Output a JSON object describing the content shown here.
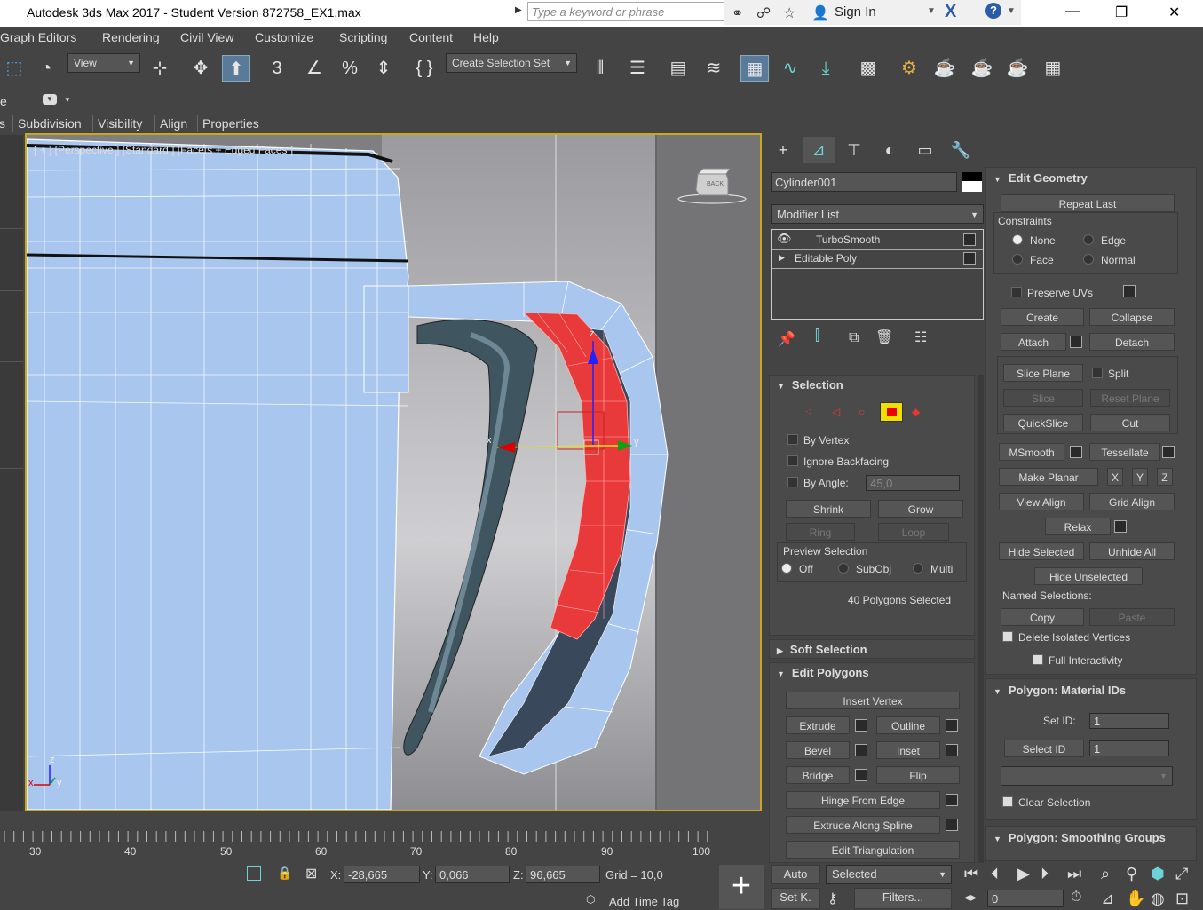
{
  "window": {
    "title": "Autodesk 3ds Max 2017 - Student Version    872758_EX1.max",
    "search_placeholder": "Type a keyword or phrase",
    "sign_in": "Sign In",
    "minimize": "—",
    "restore": "❐",
    "close": "✕"
  },
  "menu": [
    "Graph Editors",
    "Rendering",
    "Civil View",
    "Customize",
    "Scripting",
    "Content",
    "Help"
  ],
  "toolbar": {
    "view_dropdown": "View",
    "selection_set": "Create Selection Set"
  },
  "row2": {
    "left_text": "e"
  },
  "ribbon": [
    "s",
    "Subdivision",
    "Visibility",
    "Align",
    "Properties"
  ],
  "viewport": {
    "label": "[ + ] [Perspective ] [Standard ] [Facets + Edged Faces ]",
    "viewcube_label": "BACK",
    "gizmo": {
      "x": "x",
      "y": "y",
      "z": "z"
    },
    "axis": {
      "x": "x",
      "y": "y",
      "z": "z"
    }
  },
  "timeline": {
    "ticks": [
      "30",
      "40",
      "50",
      "60",
      "70",
      "80",
      "90",
      "100"
    ]
  },
  "status": {
    "x_label": "X:",
    "x_value": "-28,665",
    "y_label": "Y:",
    "y_value": "0,066",
    "z_label": "Z:",
    "z_value": "96,665",
    "grid": "Grid = 10,0",
    "add_time_tag": "Add Time Tag",
    "auto": "Auto",
    "set_key": "Set K.",
    "selected": "Selected",
    "filters": "Filters...",
    "frame": "0"
  },
  "command_panel": {
    "object_name": "Cylinder001",
    "modifier_list": "Modifier List",
    "stack": [
      "TurboSmooth",
      "Editable Poly"
    ],
    "selection": {
      "title": "Selection",
      "by_vertex": "By Vertex",
      "ignore_backfacing": "Ignore Backfacing",
      "by_angle": "By Angle:",
      "angle_value": "45,0",
      "shrink": "Shrink",
      "grow": "Grow",
      "ring": "Ring",
      "loop": "Loop",
      "preview_selection": "Preview Selection",
      "off": "Off",
      "subobj": "SubObj",
      "multi": "Multi",
      "status": "40 Polygons Selected"
    },
    "soft_selection": "Soft Selection",
    "edit_polygons": {
      "title": "Edit Polygons",
      "insert_vertex": "Insert Vertex",
      "extrude": "Extrude",
      "outline": "Outline",
      "bevel": "Bevel",
      "inset": "Inset",
      "bridge": "Bridge",
      "flip": "Flip",
      "hinge": "Hinge From Edge",
      "extrude_spline": "Extrude Along Spline",
      "edit_triangulation": "Edit Triangulation"
    },
    "edit_geometry": {
      "title": "Edit Geometry",
      "repeat_last": "Repeat Last",
      "constraints": "Constraints",
      "none": "None",
      "edge": "Edge",
      "face": "Face",
      "normal": "Normal",
      "preserve_uvs": "Preserve UVs",
      "create": "Create",
      "collapse": "Collapse",
      "attach": "Attach",
      "detach": "Detach",
      "slice_plane": "Slice Plane",
      "split": "Split",
      "slice": "Slice",
      "reset_plane": "Reset Plane",
      "quickslice": "QuickSlice",
      "cut": "Cut",
      "msmooth": "MSmooth",
      "tessellate": "Tessellate",
      "make_planar": "Make Planar",
      "x": "X",
      "y": "Y",
      "z": "Z",
      "view_align": "View Align",
      "grid_align": "Grid Align",
      "relax": "Relax",
      "hide_selected": "Hide Selected",
      "unhide_all": "Unhide All",
      "hide_unselected": "Hide Unselected",
      "named_selections": "Named Selections:",
      "copy": "Copy",
      "paste": "Paste",
      "delete_isolated": "Delete Isolated Vertices",
      "full_interactivity": "Full Interactivity"
    },
    "material_ids": {
      "title": "Polygon: Material IDs",
      "set_id": "Set ID:",
      "set_id_value": "1",
      "select_id": "Select ID",
      "select_id_value": "1",
      "clear_selection": "Clear Selection"
    },
    "smoothing_groups": "Polygon: Smoothing Groups"
  },
  "colors": {
    "accent": "#c9a81d",
    "selection_red": "#e83a3a",
    "mesh_blue": "#a9c6ee",
    "active_button": "#5a7a9a"
  }
}
